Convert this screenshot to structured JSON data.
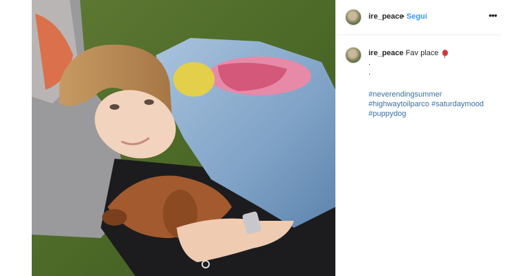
{
  "post": {
    "username": "ire_peace",
    "separator": "•",
    "follow_label": "Segui",
    "more_label": "•••",
    "caption": {
      "username": "ire_peace",
      "text": "Fav place",
      "line2": ".",
      "line3": ".",
      "hashtags": [
        "#neverendingsummer",
        "#highwaytoilparco",
        "#saturdaymood",
        "#puppydog"
      ]
    }
  },
  "colors": {
    "link": "#3897f0",
    "hashtag": "#3a6fa0",
    "text": "#262626"
  },
  "icons": {
    "more": "more-options-icon",
    "balloon": "balloon-icon"
  }
}
